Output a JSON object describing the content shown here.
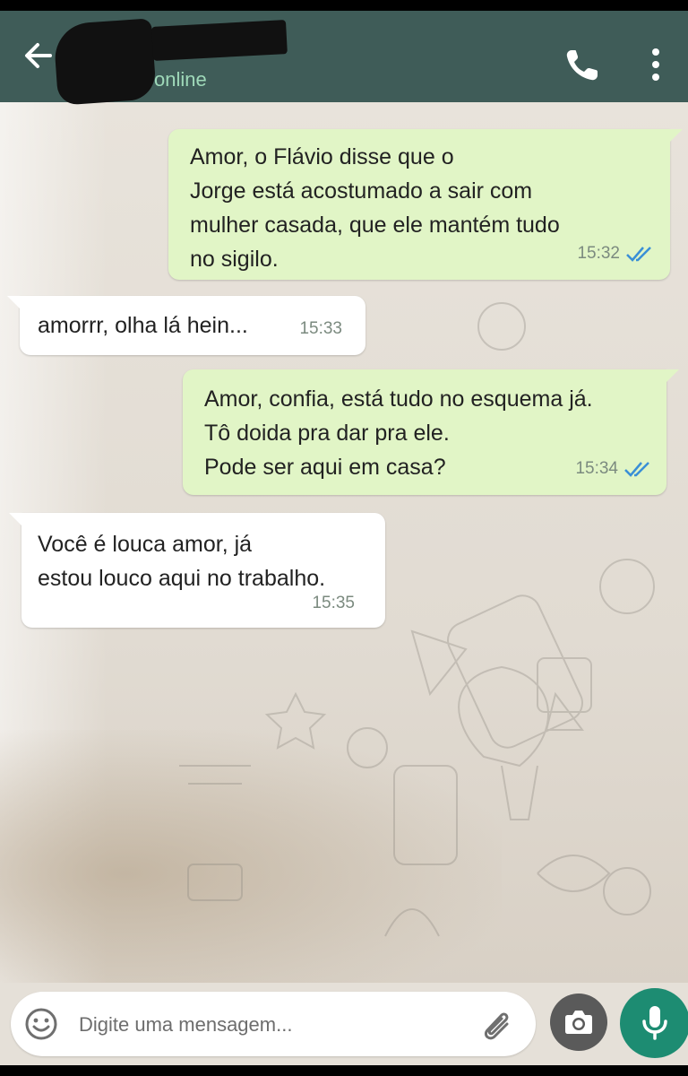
{
  "header": {
    "contact_name": "",
    "status": "online",
    "colors": {
      "bar": "#3f5c58",
      "status": "#9fd9b9"
    },
    "icons": [
      "back-arrow-icon",
      "phone-icon",
      "more-vert-icon"
    ]
  },
  "messages": [
    {
      "direction": "outgoing",
      "text": "Amor, o Flávio disse que o\nJorge está acostumado a sair com\nmulher casada, que ele mantém tudo\nno sigilo.",
      "time": "15:32",
      "read": true
    },
    {
      "direction": "incoming",
      "text": "amorrr, olha lá hein...",
      "time": "15:33"
    },
    {
      "direction": "outgoing",
      "text": "Amor, confia, está tudo no esquema já.\nTô doida pra dar pra ele.\nPode ser aqui em casa?",
      "time": "15:34",
      "read": true
    },
    {
      "direction": "incoming",
      "text": "Você é louca amor, já\nestou louco aqui no trabalho.",
      "time": "15:35"
    }
  ],
  "input": {
    "placeholder": "Digite uma mensagem...",
    "icons": [
      "emoji-icon",
      "paperclip-icon",
      "camera-icon",
      "mic-icon"
    ]
  },
  "colors": {
    "outgoing_bubble": "#e1f5c6",
    "incoming_bubble": "#ffffff",
    "read_ticks": "#3a8fd6",
    "mic_button": "#1d8c72"
  }
}
